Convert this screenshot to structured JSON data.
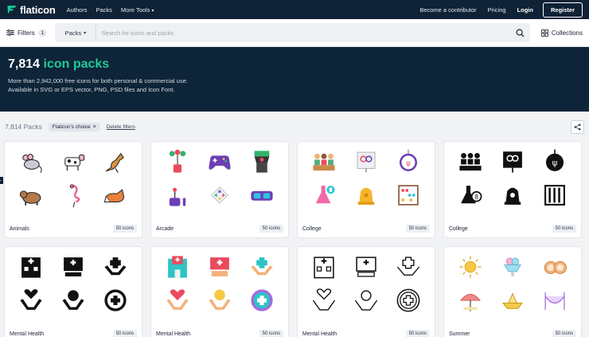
{
  "nav": {
    "logo_text": "flaticon",
    "links": [
      "Authors",
      "Packs",
      "More Tools"
    ],
    "right_links": [
      "Become a contributor",
      "Pricing"
    ],
    "login": "Login",
    "register": "Register"
  },
  "search": {
    "filters_label": "Filters",
    "filters_count": "1",
    "type_selected": "Packs",
    "placeholder": "Search for icons and packs",
    "collections_label": "Collections"
  },
  "hero": {
    "count": "7,814",
    "title_accent": "icon packs",
    "line1": "More than 2,942,000 free icons for both personal & commercial use.",
    "line2": "Available in SVG or EPS vector, PNG, PSD files and Icon Font."
  },
  "filter_row": {
    "count_text": "7,814 Packs",
    "chip_label": "Flaticon's choice",
    "chip_close": "×",
    "delete_label": "Delete filters"
  },
  "cards": [
    {
      "name": "Animals",
      "badge": "50 icons",
      "style": "lineal-color"
    },
    {
      "name": "Arcade",
      "badge": "50 icons",
      "style": "flat"
    },
    {
      "name": "College",
      "badge": "50 icons",
      "style": "flat"
    },
    {
      "name": "College",
      "badge": "50 icons",
      "style": "glyph"
    },
    {
      "name": "Mental Health",
      "badge": "50 icons",
      "style": "glyph"
    },
    {
      "name": "Mental Health",
      "badge": "50 icons",
      "style": "flat"
    },
    {
      "name": "Mental Health",
      "badge": "50 icons",
      "style": "lineal"
    },
    {
      "name": "Summer",
      "badge": "50 icons",
      "style": "lineal-color"
    }
  ],
  "colors": {
    "nav_bg": "#0f2236",
    "hero_bg": "#0e2438",
    "accent": "#20c997"
  }
}
